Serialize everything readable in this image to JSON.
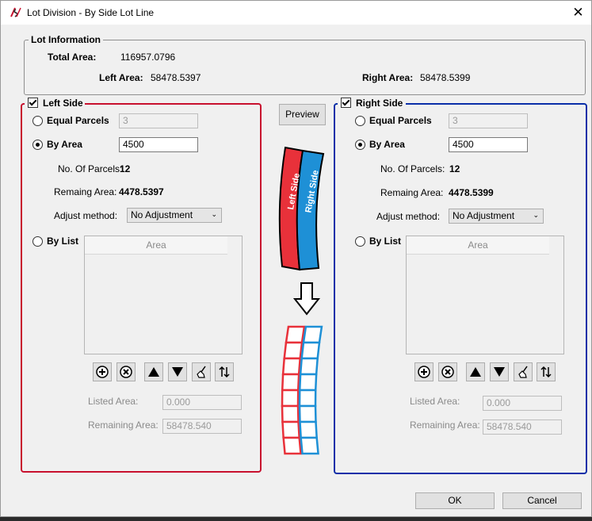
{
  "window": {
    "title": "Lot Division - By Side Lot Line",
    "close_glyph": "✕",
    "app_icon": "app-logo-icon"
  },
  "lot_info": {
    "group_label": "Lot Information",
    "total_area_label": "Total Area:",
    "total_area_value": "116957.0796",
    "left_area_label": "Left Area:",
    "left_area_value": "58478.5397",
    "right_area_label": "Right Area:",
    "right_area_value": "58478.5399"
  },
  "left": {
    "group_label": "Left Side",
    "checked": true,
    "accent_color": "#c8102e",
    "equal_parcels_label": "Equal Parcels",
    "equal_parcels_value": "3",
    "by_area_label": "By Area",
    "by_area_value": "4500",
    "num_parcels_label": "No. Of Parcels:",
    "num_parcels_value": "12",
    "remaining_label": "Remaing Area:",
    "remaining_value": "4478.5397",
    "adjust_label": "Adjust method:",
    "adjust_value": "No Adjustment",
    "by_list_label": "By List",
    "list_column": "Area",
    "listed_area_label": "Listed Area:",
    "listed_area_value": "0.000",
    "remaining_area_label": "Remaining Area:",
    "remaining_area_value": "58478.540",
    "selected_mode": "By Area"
  },
  "right": {
    "group_label": "Right Side",
    "checked": true,
    "accent_color": "#0a2fa8",
    "equal_parcels_label": "Equal Parcels",
    "equal_parcels_value": "3",
    "by_area_label": "By Area",
    "by_area_value": "4500",
    "num_parcels_label": "No. Of Parcels:",
    "num_parcels_value": "12",
    "remaining_label": "Remaing Area:",
    "remaining_value": "4478.5399",
    "adjust_label": "Adjust method:",
    "adjust_value": "No Adjustment",
    "by_list_label": "By List",
    "list_column": "Area",
    "listed_area_label": "Listed Area:",
    "listed_area_value": "0.000",
    "remaining_area_label": "Remaining Area:",
    "remaining_area_value": "58478.540",
    "selected_mode": "By Area"
  },
  "toolbar_icons": [
    "add-icon",
    "delete-icon",
    "move-up-icon",
    "move-down-icon",
    "clear-icon",
    "sort-icon"
  ],
  "preview": {
    "button_label": "Preview",
    "left_side_text": "Left Side",
    "right_side_text": "Right Side",
    "left_color": "#e8313a",
    "right_color": "#1e90d6"
  },
  "footer": {
    "ok_label": "OK",
    "cancel_label": "Cancel"
  }
}
